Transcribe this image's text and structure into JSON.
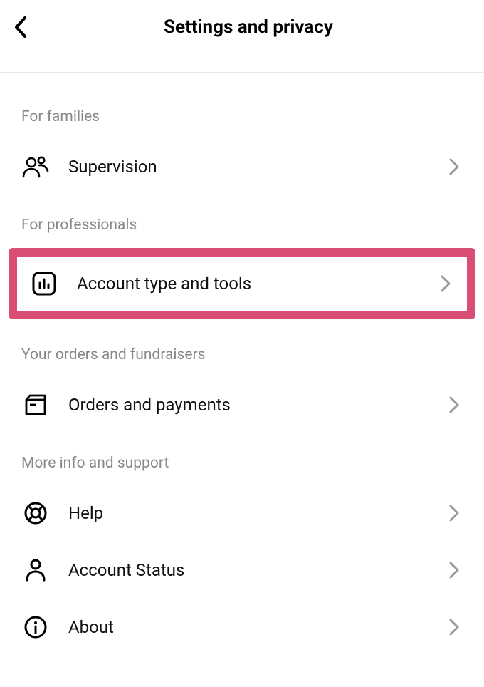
{
  "header": {
    "title": "Settings and privacy"
  },
  "sections": {
    "families": {
      "header": "For families",
      "items": [
        {
          "label": "Supervision"
        }
      ]
    },
    "professionals": {
      "header": "For professionals",
      "items": [
        {
          "label": "Account type and tools"
        }
      ]
    },
    "orders": {
      "header": "Your orders and fundraisers",
      "items": [
        {
          "label": "Orders and payments"
        }
      ]
    },
    "support": {
      "header": "More info and support",
      "items": [
        {
          "label": "Help"
        },
        {
          "label": "Account Status"
        },
        {
          "label": "About"
        }
      ]
    }
  }
}
